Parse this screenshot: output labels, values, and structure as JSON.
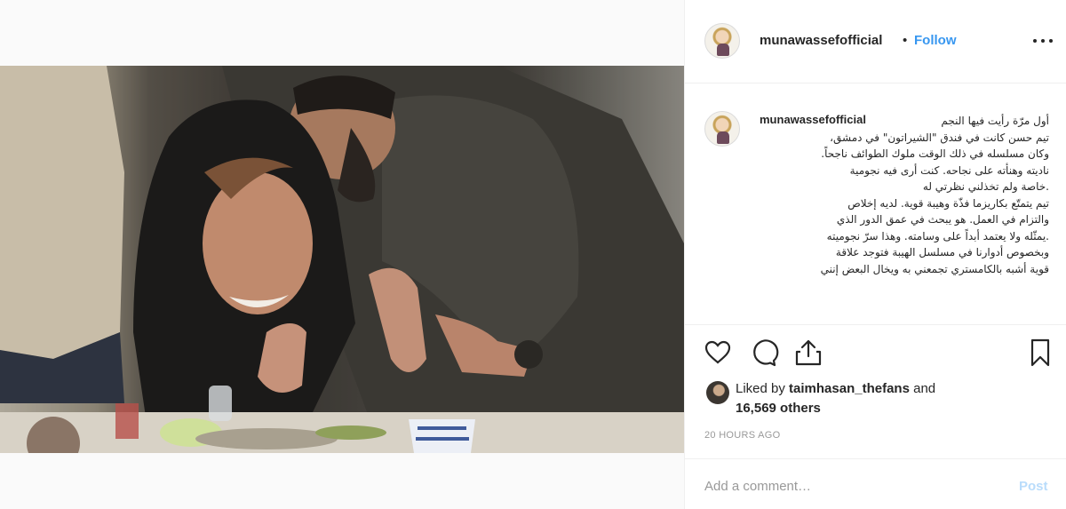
{
  "post": {
    "username": "munawassefofficial",
    "separator": "•",
    "follow_label": "Follow",
    "more_icon": "more-options-icon"
  },
  "caption": {
    "username": "munawassefofficial",
    "text": "أول مرّة رأيت فيها النجم\nتيم حسن كانت في فندق \"الشيراتون\" في دمشق،\nوكان مسلسله في ذلك الوقت ملوك الطوائف ناجحاً.\nناديته وهنأته على نجاحه. كنت أرى فيه نجومية\n.خاصة ولم تخذلني نظرتي له\nتيم يتمتّع بكاريزما فذّة وهيبة قوية. لديه إخلاص\nوالتزام في العمل. هو يبحث في عمق الدور الذي\n.يمثّله ولا يعتمد أبداً على وسامته. وهذا سرّ نجوميته\nوبخصوص أدوارنا في مسلسل الهيبة فتوجد علاقة\nقوية أشبه بالكامستري تجمعني به ويخال البعض إنني"
  },
  "actions": {
    "like_icon": "heart-icon",
    "comment_icon": "comment-bubble-icon",
    "share_icon": "share-icon",
    "save_icon": "bookmark-icon"
  },
  "likes": {
    "prefix": "Liked by",
    "liker": "taimhasan_thefans",
    "conjunction": "and",
    "others": "16,569 others"
  },
  "timestamp": "20 HOURS AGO",
  "comment": {
    "placeholder": "Add a comment…",
    "post_label": "Post"
  },
  "colors": {
    "link_blue": "#3897f0",
    "post_disabled": "#b9dcfb",
    "muted_gray": "#999999",
    "text": "#262626"
  }
}
